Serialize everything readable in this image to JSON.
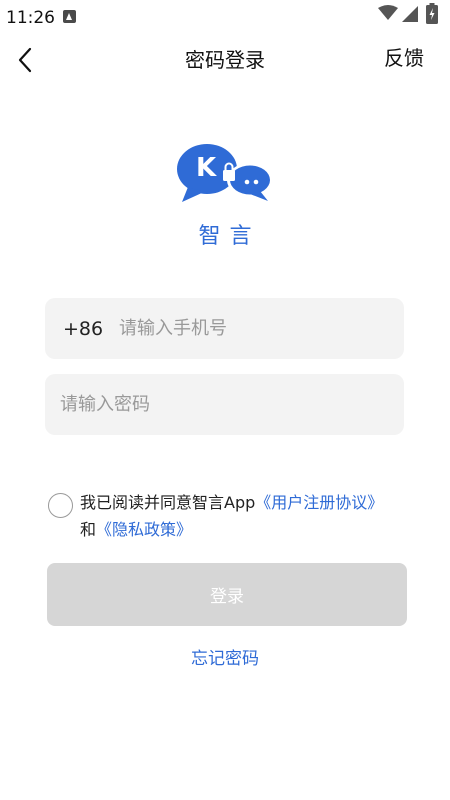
{
  "status_bar": {
    "time": "11:26"
  },
  "header": {
    "title": "密码登录",
    "feedback": "反馈"
  },
  "brand": {
    "name": "智言",
    "logo_letter": "K",
    "color": "#2f6bd6"
  },
  "form": {
    "country_code": "+86",
    "phone_placeholder": "请输入手机号",
    "password_placeholder": "请输入密码"
  },
  "agreement": {
    "prefix": "我已阅读并同意智言App",
    "user_agreement": "《用户注册协议》",
    "conjunction": "和",
    "privacy_policy": "《隐私政策》"
  },
  "login_label": "登录",
  "forgot_password": "忘记密码",
  "colors": {
    "accent": "#2f6bd6",
    "button_disabled": "#d6d6d6",
    "field_bg": "#f3f3f3"
  }
}
